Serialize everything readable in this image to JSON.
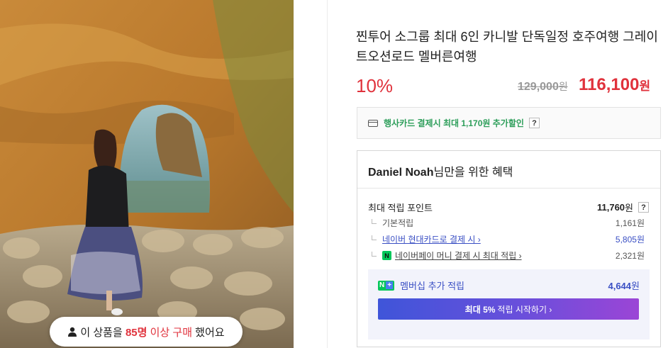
{
  "photo": {
    "buy_notice": {
      "prefix": "이 상품을 ",
      "count": "85명",
      "middle": " 이상 구매",
      "suffix": " 했어요"
    }
  },
  "product": {
    "title": "찐투어 소그룹 최대 6인 카니발 단독일정 호주여행 그레이트오션로드 멜버른여행",
    "discount": "10%",
    "original_price": "129,000",
    "original_unit": "원",
    "sale_price": "116,100",
    "sale_unit": "원"
  },
  "card_promo": {
    "text": "행사카드 결제시 최대 1,170원 추가할인",
    "help": "?",
    "icon": "card-icon"
  },
  "benefit": {
    "user_name": "Daniel Noah",
    "title_suffix": "님만을 위한 혜택",
    "max_points_label": "최대 적립 포인트",
    "max_points_value": "11,760",
    "max_points_unit": "원",
    "help": "?",
    "rows": [
      {
        "label": "기본적립",
        "value": "1,161원"
      },
      {
        "label": "네이버 현대카드로 결제 시 ›",
        "value": "5,805원"
      },
      {
        "label": "네이버페이 머니 결제 시 최대 적립 ›",
        "value": "2,321원",
        "badge": "N"
      }
    ],
    "membership": {
      "badge_n": "N",
      "badge_plus": "+",
      "label": "멤버십 추가 적립",
      "value": "4,644",
      "unit": "원",
      "button_bold": "최대 5%",
      "button_text": "적립 시작하기 ›"
    }
  },
  "colors": {
    "accent_red": "#e0323c",
    "accent_blue": "#3a4fc4",
    "naver_green": "#03c75a"
  }
}
